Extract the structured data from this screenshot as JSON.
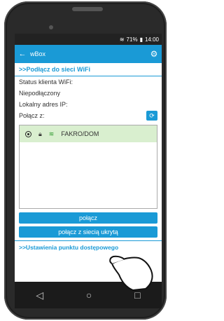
{
  "status_bar": {
    "battery": "71%",
    "time": "14:00"
  },
  "app_bar": {
    "title": "wBox"
  },
  "section_wifi": {
    "title": ">>Podłącz do sieci WiFi"
  },
  "labels": {
    "status": "Status klienta WiFi:",
    "state": "Niepodłączony",
    "ip": "Lokalny adres IP:",
    "connect_with": "Połącz z:"
  },
  "network": {
    "name": "FAKRO/DOM"
  },
  "buttons": {
    "connect": "połącz",
    "connect_hidden": "połącz z siecią ukrytą"
  },
  "section_ap": {
    "title": ">>Ustawienia punktu dostępowego"
  },
  "icons": {
    "back": "arrow-left-icon",
    "settings": "gear-icon",
    "refresh": "refresh-icon",
    "lock": "lock-icon",
    "wifi": "wifi-icon",
    "nav_back": "triangle-back-icon",
    "nav_home": "circle-home-icon",
    "nav_recent": "square-recent-icon"
  },
  "colors": {
    "accent": "#1a9ad6",
    "selected_row": "#d9efcf"
  }
}
